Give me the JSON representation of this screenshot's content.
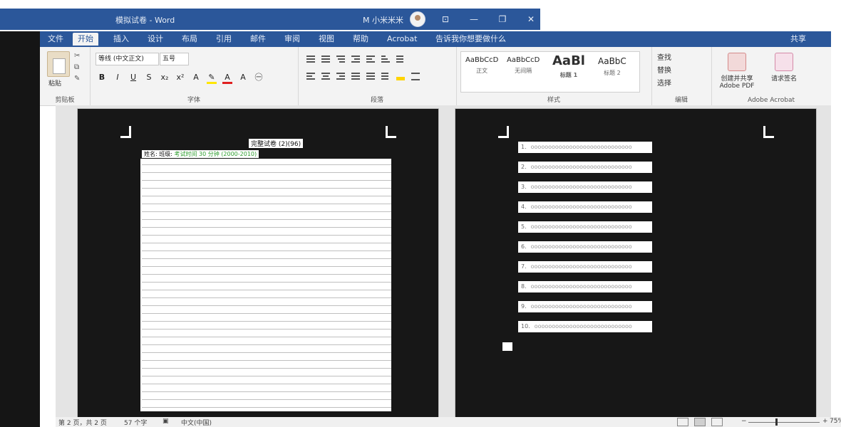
{
  "window": {
    "title": "模拟试卷 - Word",
    "user": "M 小米米米",
    "buttons": {
      "minimize": "—",
      "maximize": "❐",
      "close": "✕",
      "ribbon_options": "⊡"
    }
  },
  "ribbon": {
    "tabs": [
      {
        "label": "文件"
      },
      {
        "label": "开始"
      },
      {
        "label": "插入"
      },
      {
        "label": "设计"
      },
      {
        "label": "布局"
      },
      {
        "label": "引用"
      },
      {
        "label": "邮件"
      },
      {
        "label": "审阅"
      },
      {
        "label": "视图"
      },
      {
        "label": "帮助"
      },
      {
        "label": "Acrobat"
      },
      {
        "label": "告诉我你想要做什么"
      },
      {
        "label": "共享"
      }
    ],
    "clipboard": {
      "paste": "粘贴",
      "group": "剪贴板"
    },
    "font": {
      "name": "等线 (中文正文)",
      "size": "五号",
      "group": "字体"
    },
    "paragraph": {
      "group": "段落"
    },
    "styles": {
      "group": "样式",
      "items": [
        {
          "sample": "AaBbCcD",
          "name": "正文"
        },
        {
          "sample": "AaBbCcD",
          "name": "无间隔"
        },
        {
          "sample": "AaBl",
          "name": "标题 1"
        },
        {
          "sample": "AaBbC",
          "name": "标题 2"
        }
      ]
    },
    "editing": {
      "find": "查找",
      "replace": "替换",
      "select": "选择",
      "group": "编辑"
    },
    "acrobat": {
      "create_share": "创建并共享 Adobe PDF",
      "request_sign": "请求签名",
      "group": "Adobe Acrobat"
    }
  },
  "document": {
    "page1": {
      "title": "完整试卷 (2)(96)",
      "subtitle_prefix": "姓名: 班级:",
      "subtitle_highlight": "考试时间 30 分钟 (2000-2010)"
    },
    "page2": {
      "items": [
        {
          "num": "1.",
          "text": "ooooooooooooooooooooooooooooo"
        },
        {
          "num": "2.",
          "text": "ooooooooooooooooooooooooooooo"
        },
        {
          "num": "3.",
          "text": "ooooooooooooooooooooooooooooo"
        },
        {
          "num": "4.",
          "text": "ooooooooooooooooooooooooooooo"
        },
        {
          "num": "5.",
          "text": "ooooooooooooooooooooooooooooo"
        },
        {
          "num": "6.",
          "text": "ooooooooooooooooooooooooooooo"
        },
        {
          "num": "7.",
          "text": "ooooooooooooooooooooooooooooo"
        },
        {
          "num": "8.",
          "text": "ooooooooooooooooooooooooooooo"
        },
        {
          "num": "9.",
          "text": "ooooooooooooooooooooooooooooo"
        },
        {
          "num": "10.",
          "text": "oooooooooooooooooooooooooooo"
        }
      ]
    }
  },
  "statusbar": {
    "page": "第 2 页，共 2 页",
    "words": "57 个字",
    "language": "中文(中国)",
    "zoom": "75%"
  }
}
